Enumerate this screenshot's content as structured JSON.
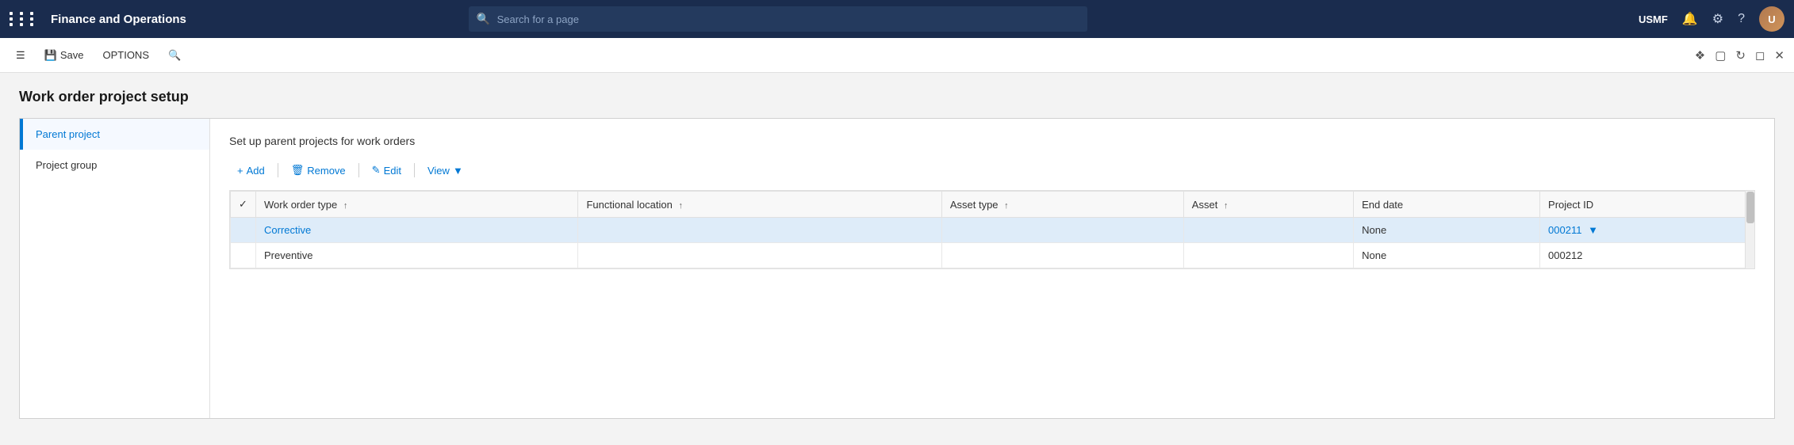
{
  "topNav": {
    "title": "Finance and Operations",
    "searchPlaceholder": "Search for a page",
    "userLabel": "USMF",
    "avatarInitial": "U"
  },
  "toolbar": {
    "saveLabel": "Save",
    "optionsLabel": "OPTIONS",
    "closeLabel": "×"
  },
  "page": {
    "title": "Work order project setup",
    "sectionTitle": "Set up parent projects for work orders"
  },
  "sidebar": {
    "items": [
      {
        "label": "Parent project",
        "active": true
      },
      {
        "label": "Project group",
        "active": false
      }
    ]
  },
  "actionBar": {
    "addLabel": "Add",
    "removeLabel": "Remove",
    "editLabel": "Edit",
    "viewLabel": "View"
  },
  "table": {
    "columns": [
      {
        "label": "Work order type",
        "sortable": true
      },
      {
        "label": "Functional location",
        "sortable": true
      },
      {
        "label": "Asset type",
        "sortable": true
      },
      {
        "label": "Asset",
        "sortable": true
      },
      {
        "label": "End date",
        "sortable": false
      },
      {
        "label": "Project ID",
        "sortable": false
      }
    ],
    "rows": [
      {
        "selected": true,
        "workOrderType": "Corrective",
        "functionalLocation": "",
        "assetType": "",
        "asset": "",
        "endDate": "None",
        "projectId": "000211",
        "hasDropdown": true
      },
      {
        "selected": false,
        "workOrderType": "Preventive",
        "functionalLocation": "",
        "assetType": "",
        "asset": "",
        "endDate": "None",
        "projectId": "000212",
        "hasDropdown": false
      }
    ]
  }
}
